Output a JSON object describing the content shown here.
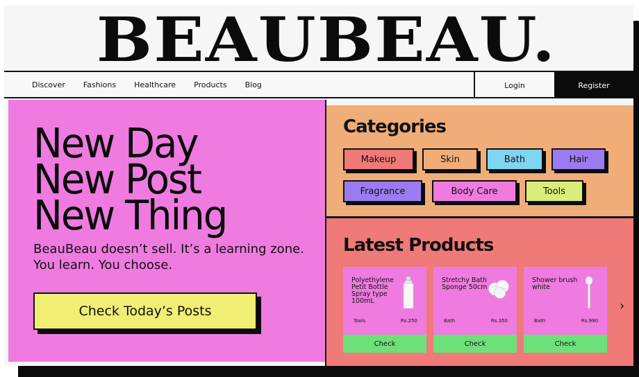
{
  "brand": {
    "logo": "BEAUBEAU."
  },
  "nav": {
    "links": [
      "Discover",
      "Fashions",
      "Healthcare",
      "Products",
      "Blog"
    ],
    "login": "Login",
    "register": "Register"
  },
  "hero": {
    "lines": [
      "New Day",
      "New Post",
      "New Thing"
    ],
    "description": "BeauBeau doesn’t sell. It’s a learning zone. You learn. You choose.",
    "cta": "Check  Today’s  Posts"
  },
  "categories": {
    "title": "Categories",
    "items": [
      {
        "label": "Makeup",
        "color": "#ef7a78"
      },
      {
        "label": "Skin",
        "color": "#f0ad78"
      },
      {
        "label": "Bath",
        "color": "#7fd4f2"
      },
      {
        "label": "Hair",
        "color": "#9b7cf0"
      },
      {
        "label": "Fragrance",
        "color": "#9b7cf0"
      },
      {
        "label": "Body  Care",
        "color": "#ef7be0"
      },
      {
        "label": "Tools",
        "color": "#d9ee7a"
      }
    ]
  },
  "latest": {
    "title": "Latest Products",
    "products": [
      {
        "name": "Polyethylene Petit Bottle Spray type 100mL",
        "category": "Tools",
        "price": "Rs.250",
        "button": "Check",
        "icon": "spray-bottle-icon"
      },
      {
        "name": "Stretchy Bath Sponge 50cm",
        "category": "Bath",
        "price": "Rs.350",
        "button": "Check",
        "icon": "bath-sponge-icon"
      },
      {
        "name": "Shower brush white",
        "category": "Bath",
        "price": "Rs.990",
        "button": "Check",
        "icon": "shower-brush-icon"
      }
    ],
    "next_icon": "chevron-right-icon",
    "next_glyph": "›"
  },
  "colors": {
    "hero_bg": "#ef7be0",
    "categories_bg": "#f0ad78",
    "latest_bg": "#ef7a78",
    "cta_bg": "#f1ee74",
    "check_button": "#6ee07a"
  }
}
